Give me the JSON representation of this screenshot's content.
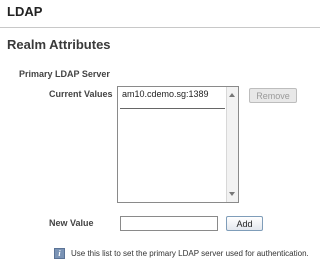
{
  "header": {
    "title": "LDAP"
  },
  "section": {
    "title": "Realm Attributes"
  },
  "subsection": {
    "title": "Primary LDAP Server"
  },
  "current_values": {
    "label": "Current Values",
    "items": [
      "am10.cdemo.sg:1389"
    ],
    "remove_label": "Remove"
  },
  "new_value": {
    "label": "New Value",
    "value": "",
    "add_label": "Add"
  },
  "help": {
    "icon": "info-icon",
    "text": "Use this list to set the primary LDAP server used for authentication."
  }
}
